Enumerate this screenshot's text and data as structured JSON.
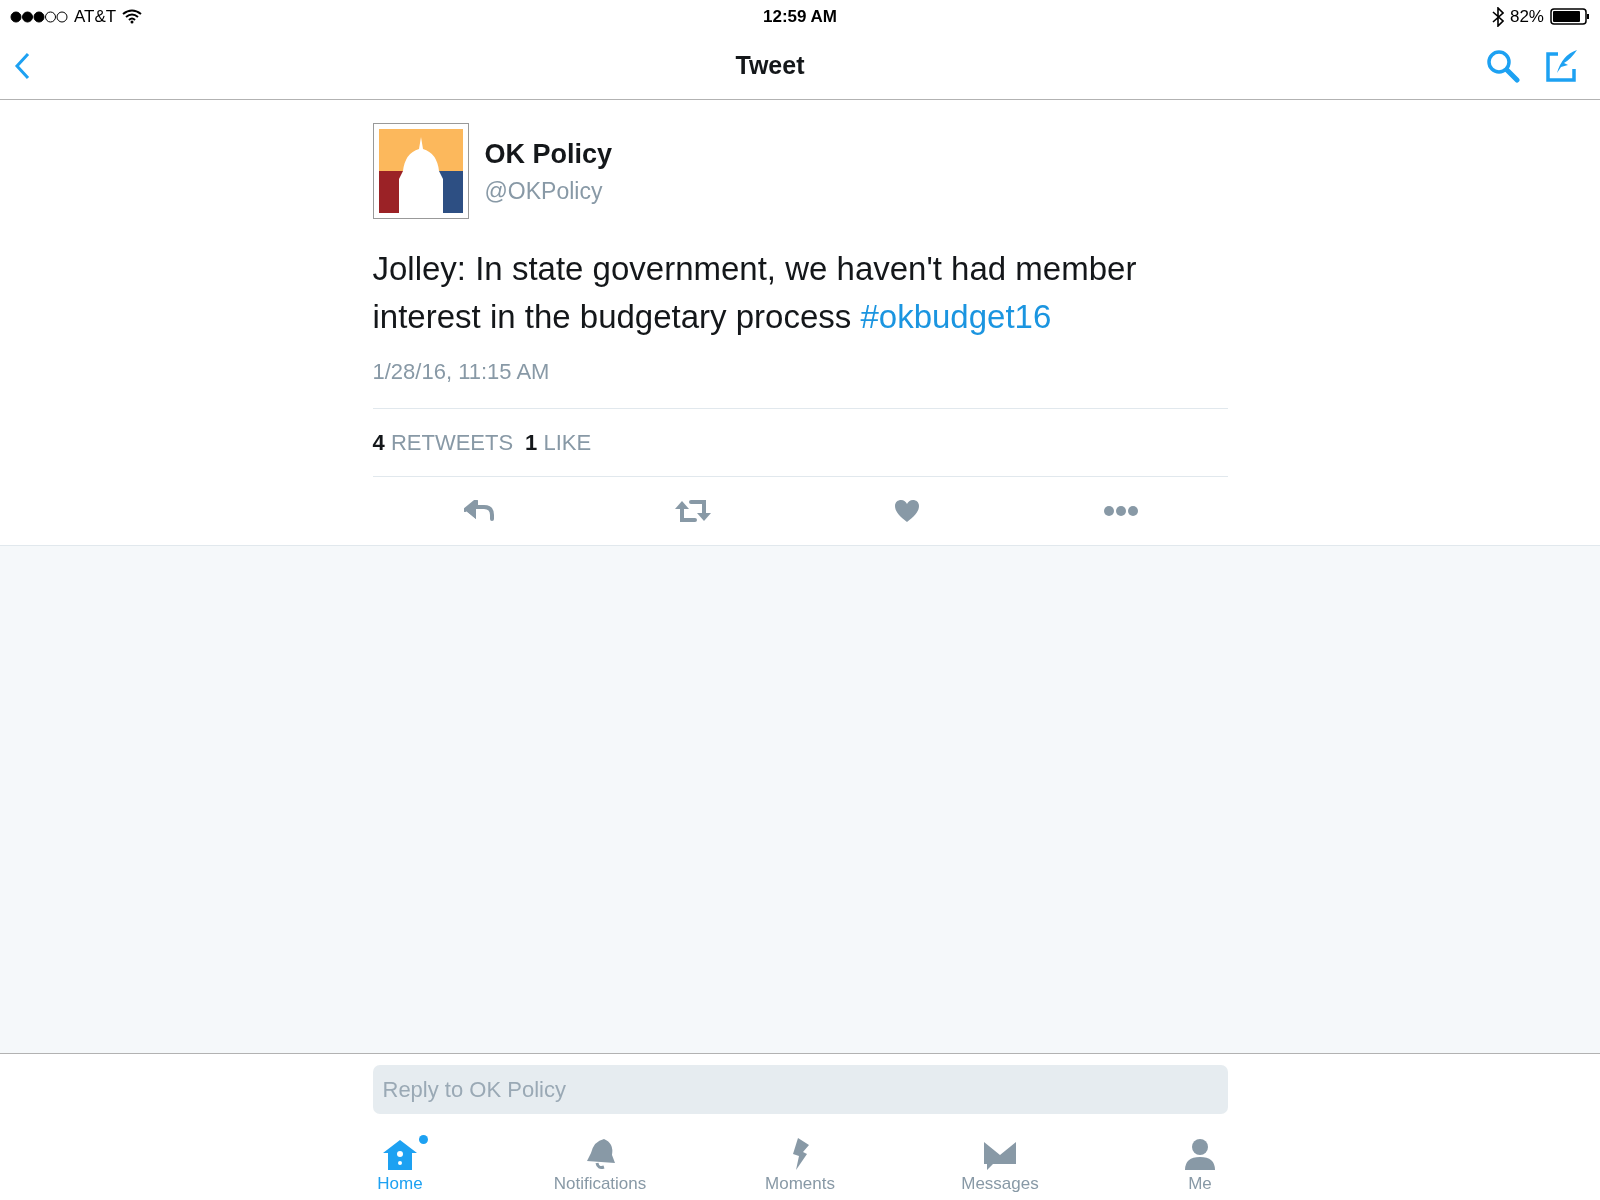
{
  "status_bar": {
    "carrier": "AT&T",
    "time": "12:59 AM",
    "battery": "82%"
  },
  "nav_bar": {
    "title": "Tweet"
  },
  "tweet": {
    "name": "OK Policy",
    "handle": "@OKPolicy",
    "text": [
      {
        "kind": "text",
        "text": "Jolley: In state government, we haven't had member interest in the budgetary process "
      },
      {
        "kind": "hashtag",
        "text": "#okbudget16"
      }
    ],
    "timestamp": "1/28/16, 11:15 AM",
    "stats": [
      {
        "count": "4",
        "label": "RETWEETS"
      },
      {
        "count": "1",
        "label": "LIKE"
      }
    ],
    "actions": [
      {
        "kind": "reply"
      },
      {
        "kind": "retweet"
      },
      {
        "kind": "like"
      },
      {
        "kind": "more"
      }
    ]
  },
  "reply": {
    "placeholder": "Reply to OK Policy"
  },
  "tab_bar": [
    {
      "kind": "home",
      "label": "Home",
      "selected": true,
      "unread": true
    },
    {
      "kind": "notifications",
      "label": "Notifications",
      "selected": false,
      "unread": false
    },
    {
      "kind": "moments",
      "label": "Moments",
      "selected": false,
      "unread": false
    },
    {
      "kind": "messages",
      "label": "Messages",
      "selected": false,
      "unread": false
    },
    {
      "kind": "me",
      "label": "Me",
      "selected": false,
      "unread": false
    }
  ]
}
